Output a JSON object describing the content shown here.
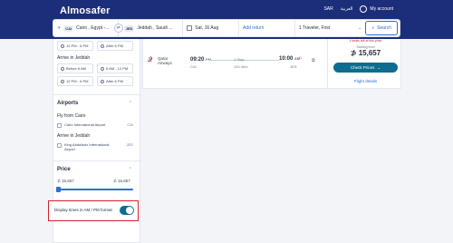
{
  "header": {
    "logo": "Almosafer",
    "currency": "SAR",
    "language": "العربية",
    "account": "My account"
  },
  "search": {
    "origin_code": "CAI",
    "origin": "Cairo , Egypt -...",
    "destination_code": "JED",
    "destination": "Jeddah , Saudi ...",
    "date": "Sat, 16 Aug",
    "add_return": "Add return",
    "travelers": "1 Traveler, First",
    "search_label": "Search"
  },
  "sidebar": {
    "depart_times_top": [
      "12 PM - 6 PM",
      "After 6 PM"
    ],
    "arrive_heading": "Arrive in Jeddah",
    "arrive_times_row1": [
      "Before 6 AM",
      "6 AM - 12 PM"
    ],
    "arrive_times_row2": [
      "12 PM - 6 PM",
      "After 6 PM"
    ],
    "airports_heading": "Airports",
    "fly_from": "Fly from Cairo",
    "from_airport": {
      "name": "Cairo International Airport",
      "code": "CAI"
    },
    "arrive_in": "Arrive in Jeddah",
    "to_airport": {
      "name": "King Abdulaziz International Airport",
      "code": "JED"
    },
    "price_heading": "Price",
    "price_min": "⊅ 15,657",
    "price_max": "⊅ 15,657",
    "toggle_label": "Display times in AM / PM format",
    "toggle_on": true
  },
  "result": {
    "airline": "Qatar Airways",
    "depart_time": "09:20",
    "depart_ampm": "PM",
    "depart_code": "CAI",
    "stops": "1 Stop",
    "duration": "12h 40m",
    "arrive_time": "10:00",
    "arrive_ampm": "AM",
    "arrive_next": "+1",
    "arrive_code": "JED",
    "seats_left": "4 seats left at this price",
    "starting_from": "Starting from",
    "price": "⊅ 15,657",
    "check_prices": "Check Prices",
    "flight_details": "Flight details"
  }
}
